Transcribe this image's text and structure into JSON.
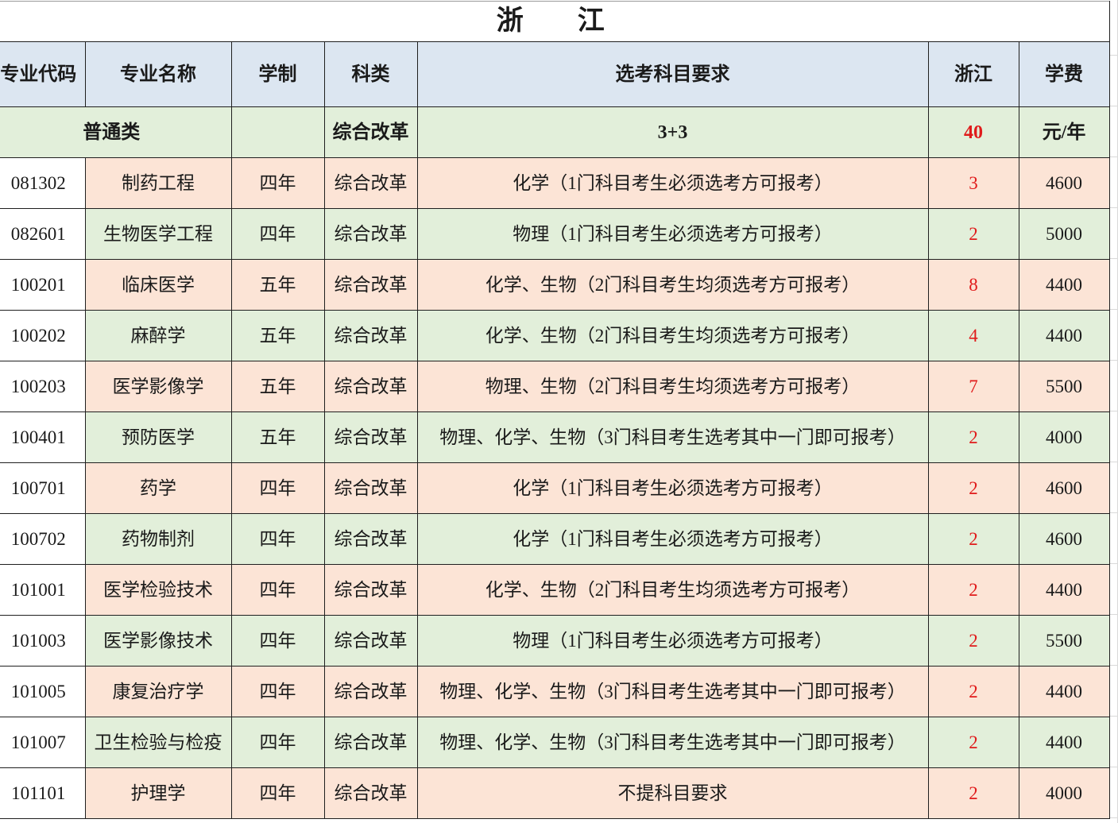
{
  "title": "浙　　江",
  "columns": {
    "code": "专业代码",
    "name": "专业名称",
    "duration": "学制",
    "category": "科类",
    "subjects": "选考科目要求",
    "quota": "浙江",
    "tuition": "学费"
  },
  "summary": {
    "label": "普通类",
    "category": "综合改革",
    "subjects": "3+3",
    "quota": "40",
    "tuition": "元/年"
  },
  "rows": [
    {
      "code": "081302",
      "name": "制药工程",
      "duration": "四年",
      "category": "综合改革",
      "subjects": "化学（1门科目考生必须选考方可报考）",
      "quota": "3",
      "tuition": "4600"
    },
    {
      "code": "082601",
      "name": "生物医学工程",
      "duration": "四年",
      "category": "综合改革",
      "subjects": "物理（1门科目考生必须选考方可报考）",
      "quota": "2",
      "tuition": "5000"
    },
    {
      "code": "100201",
      "name": "临床医学",
      "duration": "五年",
      "category": "综合改革",
      "subjects": "化学、生物（2门科目考生均须选考方可报考）",
      "quota": "8",
      "tuition": "4400"
    },
    {
      "code": "100202",
      "name": "麻醉学",
      "duration": "五年",
      "category": "综合改革",
      "subjects": "化学、生物（2门科目考生均须选考方可报考）",
      "quota": "4",
      "tuition": "4400"
    },
    {
      "code": "100203",
      "name": "医学影像学",
      "duration": "五年",
      "category": "综合改革",
      "subjects": "物理、生物（2门科目考生均须选考方可报考）",
      "quota": "7",
      "tuition": "5500"
    },
    {
      "code": "100401",
      "name": "预防医学",
      "duration": "五年",
      "category": "综合改革",
      "subjects": "物理、化学、生物（3门科目考生选考其中一门即可报考）",
      "quota": "2",
      "tuition": "4000"
    },
    {
      "code": "100701",
      "name": "药学",
      "duration": "四年",
      "category": "综合改革",
      "subjects": "化学（1门科目考生必须选考方可报考）",
      "quota": "2",
      "tuition": "4600"
    },
    {
      "code": "100702",
      "name": "药物制剂",
      "duration": "四年",
      "category": "综合改革",
      "subjects": "化学（1门科目考生必须选考方可报考）",
      "quota": "2",
      "tuition": "4600"
    },
    {
      "code": "101001",
      "name": "医学检验技术",
      "duration": "四年",
      "category": "综合改革",
      "subjects": "化学、生物（2门科目考生均须选考方可报考）",
      "quota": "2",
      "tuition": "4400"
    },
    {
      "code": "101003",
      "name": "医学影像技术",
      "duration": "四年",
      "category": "综合改革",
      "subjects": "物理（1门科目考生必须选考方可报考）",
      "quota": "2",
      "tuition": "5500"
    },
    {
      "code": "101005",
      "name": "康复治疗学",
      "duration": "四年",
      "category": "综合改革",
      "subjects": "物理、化学、生物（3门科目考生选考其中一门即可报考）",
      "quota": "2",
      "tuition": "4400"
    },
    {
      "code": "101007",
      "name": "卫生检验与检疫",
      "duration": "四年",
      "category": "综合改革",
      "subjects": "物理、化学、生物（3门科目考生选考其中一门即可报考）",
      "quota": "2",
      "tuition": "4400"
    },
    {
      "code": "101101",
      "name": "护理学",
      "duration": "四年",
      "category": "综合改革",
      "subjects": "不提科目要求",
      "quota": "2",
      "tuition": "4000"
    }
  ],
  "colors": {
    "header_bg": "#dce6f1",
    "band_green": "#e2efda",
    "band_peach": "#fce4d6",
    "quota_red": "#e01b1b",
    "border": "#1f1f1f"
  }
}
